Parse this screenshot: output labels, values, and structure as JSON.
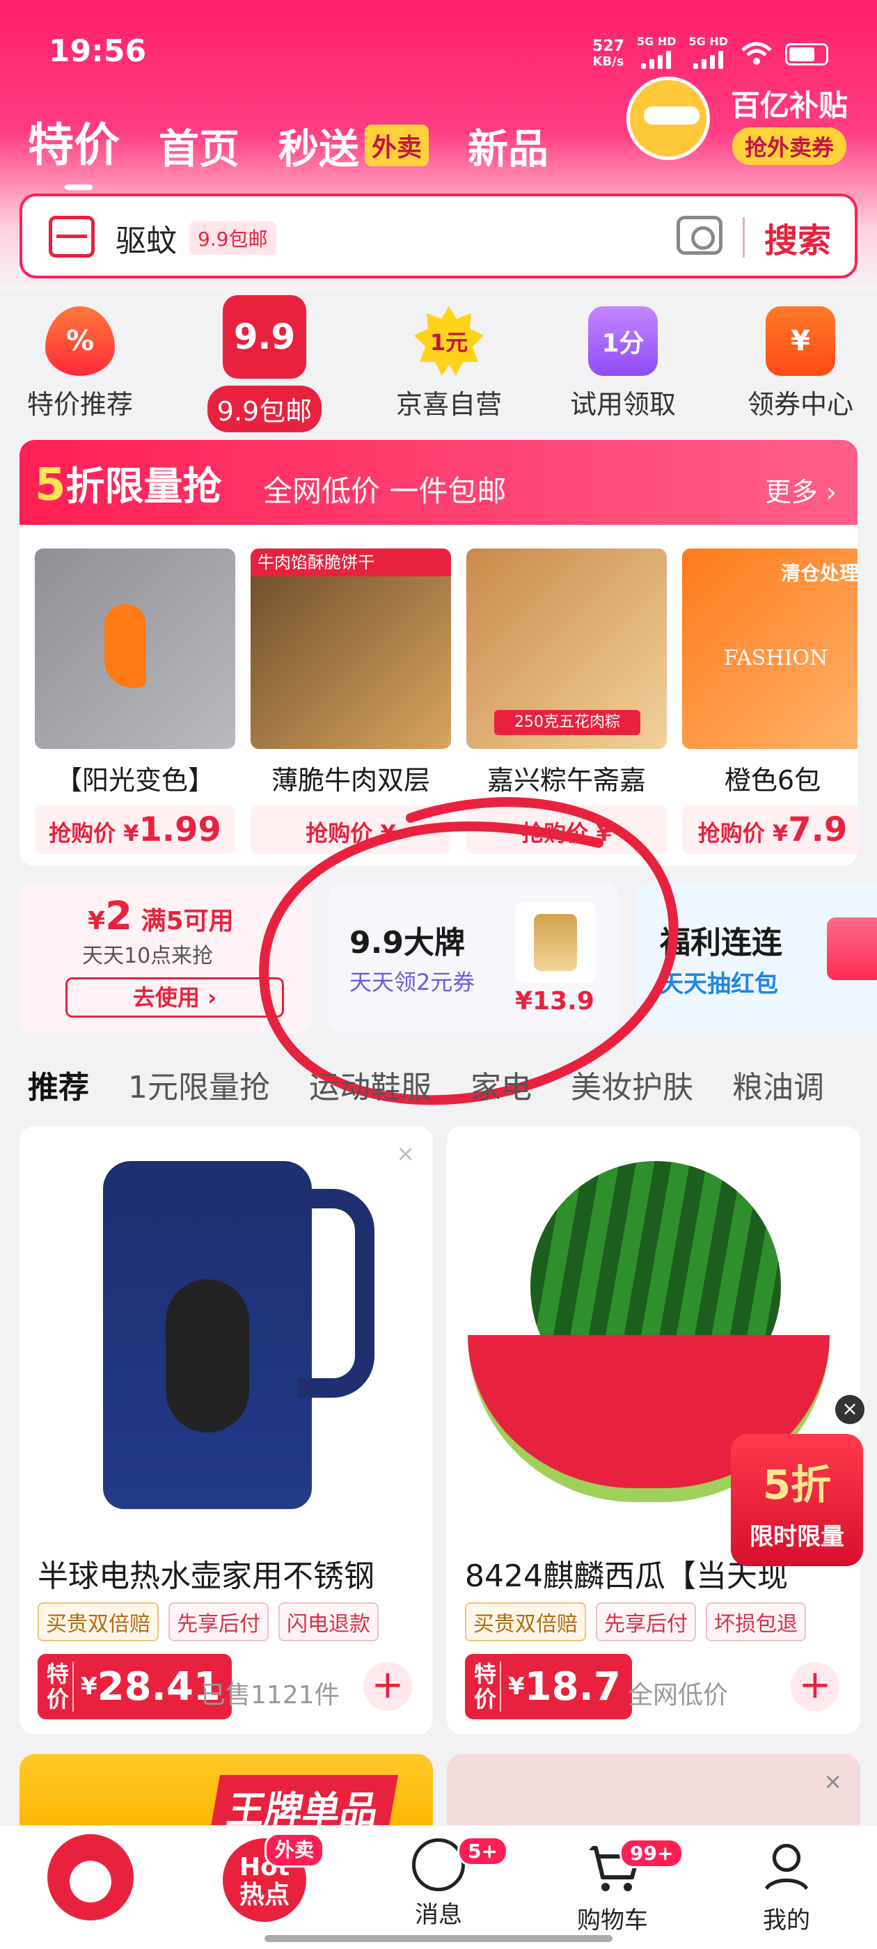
{
  "status": {
    "time": "19:56",
    "speed": "527",
    "speed_unit": "KB/s",
    "net1": "5G HD",
    "net2": "5G HD"
  },
  "topnav": {
    "tabs": [
      "特价",
      "首页",
      "秒送",
      "新品"
    ],
    "waimai_tag": "外卖"
  },
  "subsidy": {
    "title": "百亿补贴",
    "button": "抢外卖券"
  },
  "search": {
    "keyword": "驱蚊",
    "keyword_tag": "9.9包邮",
    "button": "搜索"
  },
  "categories": [
    {
      "label": "特价推荐",
      "icon": "%"
    },
    {
      "label": "9.9包邮",
      "icon": "9.9"
    },
    {
      "label": "京喜自营",
      "icon": "1元"
    },
    {
      "label": "试用领取",
      "icon": "1分"
    },
    {
      "label": "领券中心",
      "icon": "¥"
    }
  ],
  "flash": {
    "title_num": "5",
    "title": "折限量抢",
    "subtitle": "全网低价 一件包邮",
    "more": "更多 ›",
    "price_label": "抢购价",
    "currency": "¥",
    "products": [
      {
        "name": "【阳光变色】",
        "price": "1.99",
        "color1": "#8e9096",
        "color2": "#b8babf"
      },
      {
        "name": "薄脆牛肉双层",
        "price": "",
        "banner": "牛肉馅酥脆饼干",
        "color1": "#6b4a2a",
        "color2": "#d8a55e"
      },
      {
        "name": "嘉兴粽午斋嘉",
        "price": "",
        "banner": "250克五花肉粽",
        "color1": "#c98a4a",
        "color2": "#f2d19b"
      },
      {
        "name": "橙色6包",
        "price": "7.9",
        "banner": "清仓处理",
        "brand": "FASHION",
        "color1": "#ff7a1a",
        "color2": "#ffb36b"
      }
    ]
  },
  "promos": {
    "coupon": {
      "amount_prefix": "¥",
      "amount": "2",
      "condition": "满5可用",
      "desc": "天天10点来抢",
      "button": "去使用 ›"
    },
    "brand": {
      "title": "9.9大牌",
      "desc": "天天领2元券",
      "price": "¥13.9"
    },
    "welfare": {
      "title": "福利连连",
      "desc": "天天抽红包"
    }
  },
  "feed_tabs": [
    "推荐",
    "1元限量抢",
    "运动鞋服",
    "家电",
    "美妆护肤",
    "粮油调"
  ],
  "cards": [
    {
      "title": "半球电热水壶家用不锈钢",
      "tags": [
        "买贵双倍赔",
        "先享后付",
        "闪电退款"
      ],
      "price_label": "特价",
      "currency": "¥",
      "price": "28.41",
      "sub": "已售1121件"
    },
    {
      "title": "8424麒麟西瓜【当天现",
      "tags": [
        "买贵双倍赔",
        "先享后付",
        "坏损包退"
      ],
      "price_label": "特价",
      "currency": "¥",
      "price": "18.7",
      "sub": "全网低价"
    }
  ],
  "badge_5": {
    "line1": "5折",
    "line2": "限时限量"
  },
  "more_left_title": "王牌单品",
  "tabbar": [
    {
      "label": "",
      "icon": "home-mascot-icon"
    },
    {
      "label": "",
      "icon": "hot-icon",
      "text": "Hot\n热点",
      "badge": "外卖"
    },
    {
      "label": "消息",
      "icon": "message-icon",
      "badge": "5+"
    },
    {
      "label": "购物车",
      "icon": "cart-icon",
      "badge": "99+"
    },
    {
      "label": "我的",
      "icon": "user-icon"
    }
  ]
}
